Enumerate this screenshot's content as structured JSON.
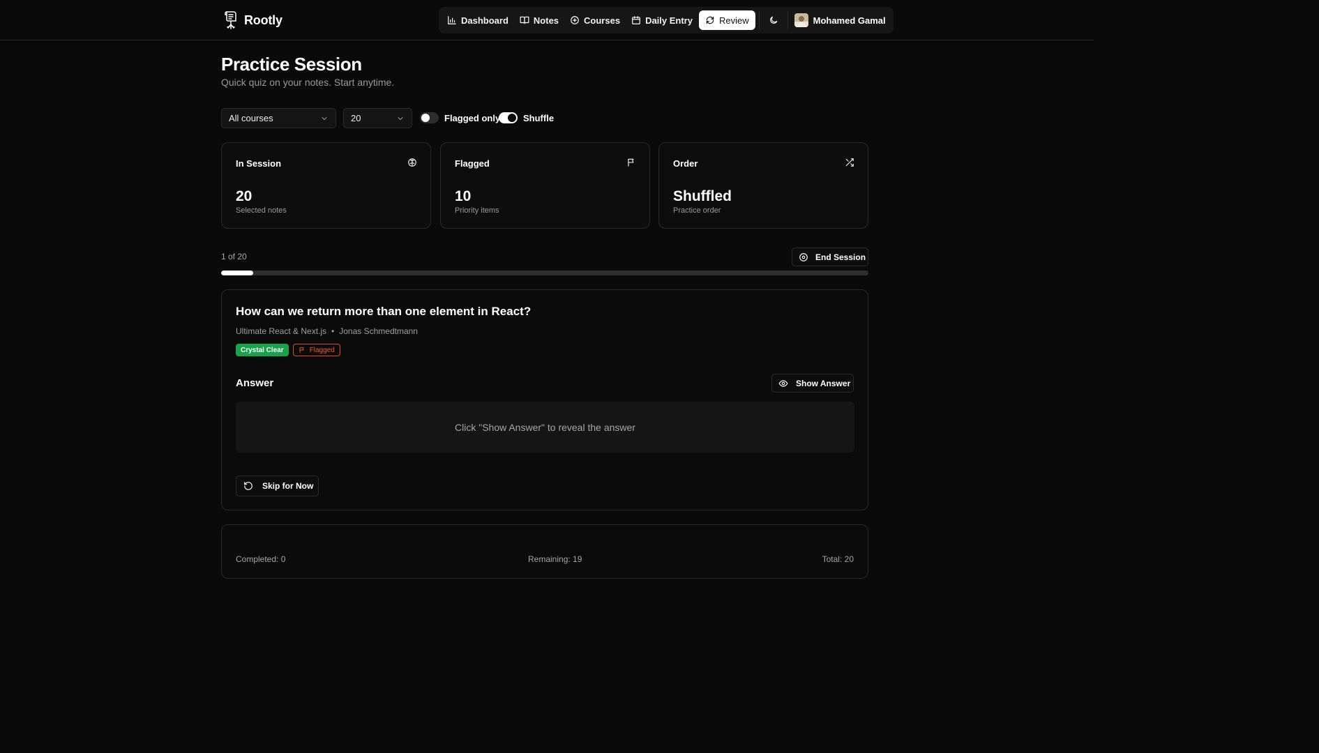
{
  "app": {
    "name": "Rootly",
    "logo_icon": "scroll-tree-logo-icon"
  },
  "nav": {
    "items": [
      {
        "label": "Dashboard",
        "icon": "bar-chart-icon"
      },
      {
        "label": "Notes",
        "icon": "book-open-icon"
      },
      {
        "label": "Courses",
        "icon": "plus-circle-icon"
      },
      {
        "label": "Daily Entry",
        "icon": "calendar-icon"
      },
      {
        "label": "Review",
        "icon": "refresh-icon",
        "active": true
      }
    ],
    "theme_icon": "moon-icon",
    "user_name": "Mohamed Gamal"
  },
  "page": {
    "title": "Practice Session",
    "subtitle": "Quick quiz on your notes. Start anytime."
  },
  "filters": {
    "course_select": "All courses",
    "count_select": "20",
    "flagged_only": {
      "label": "Flagged only",
      "on": false
    },
    "shuffle": {
      "label": "Shuffle",
      "on": true
    }
  },
  "stats": [
    {
      "label": "In Session",
      "value": "20",
      "caption": "Selected notes",
      "icon": "brain-icon"
    },
    {
      "label": "Flagged",
      "value": "10",
      "caption": "Priority items",
      "icon": "flag-icon"
    },
    {
      "label": "Order",
      "value": "Shuffled",
      "caption": "Practice order",
      "icon": "shuffle-icon"
    }
  ],
  "progress": {
    "text": "1 of 20",
    "fraction": 0.05,
    "end_label": "End Session"
  },
  "question": {
    "title": "How can we return more than one element in React?",
    "course": "Ultimate React & Next.js",
    "separator": "•",
    "instructor": "Jonas Schmedtmann",
    "badge_clarity": "Crystal Clear",
    "badge_flagged": "Flagged",
    "answer_heading": "Answer",
    "show_answer_label": "Show Answer",
    "answer_placeholder": "Click \"Show Answer\" to reveal the answer",
    "skip_label": "Skip for Now"
  },
  "summary": {
    "completed": "Completed: 0",
    "remaining": "Remaining: 19",
    "total": "Total: 20"
  },
  "colors": {
    "background": "#0a0a0a",
    "accent_green": "#16a34a",
    "flag_red": "#ef5a35"
  }
}
